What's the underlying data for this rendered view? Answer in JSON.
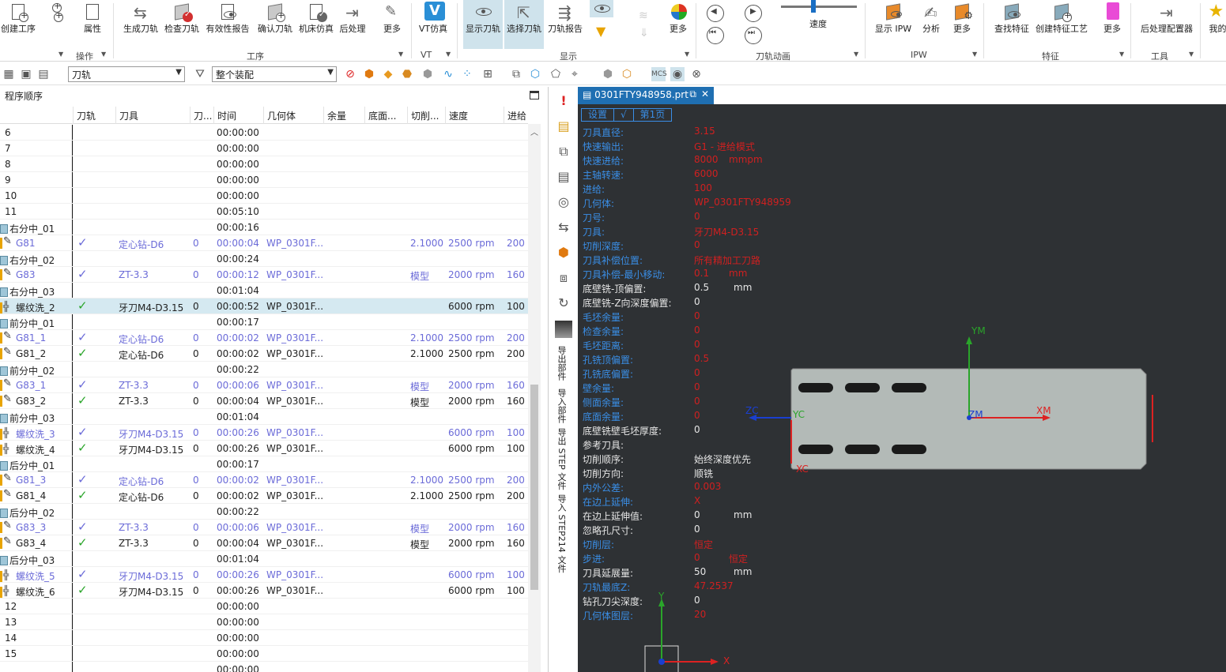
{
  "ribbon": {
    "buttons": [
      {
        "id": "create-op",
        "label": "创建工序"
      },
      {
        "id": "props",
        "label": "属性"
      },
      {
        "id": "gen-toolpath",
        "label": "生成刀轨"
      },
      {
        "id": "check-toolpath",
        "label": "检查刀轨"
      },
      {
        "id": "validity-report",
        "label": "有效性报告"
      },
      {
        "id": "confirm-toolpath",
        "label": "确认刀轨"
      },
      {
        "id": "machine-sim",
        "label": "机床仿真"
      },
      {
        "id": "postprocess",
        "label": "后处理"
      },
      {
        "id": "more-1",
        "label": "更多"
      },
      {
        "id": "vt-sim",
        "label": "VT仿真"
      },
      {
        "id": "show-toolpath",
        "label": "显示刀轨"
      },
      {
        "id": "select-toolpath",
        "label": "选择刀轨"
      },
      {
        "id": "toolpath-report",
        "label": "刀轨报告"
      },
      {
        "id": "more-2",
        "label": "更多"
      },
      {
        "id": "show-ipw",
        "label": "显示 IPW"
      },
      {
        "id": "analysis",
        "label": "分析"
      },
      {
        "id": "more-3",
        "label": "更多"
      },
      {
        "id": "find-feature",
        "label": "查找特征"
      },
      {
        "id": "create-feature-process",
        "label": "创建特征工艺"
      },
      {
        "id": "more-4",
        "label": "更多"
      },
      {
        "id": "post-configurator",
        "label": "后处理配置器"
      },
      {
        "id": "mine",
        "label": "我的"
      }
    ],
    "groups": [
      "操作",
      "工序",
      "VT",
      "显示",
      "刀轨动画",
      "IPW",
      "特征",
      "工具"
    ],
    "speed_label": "速度",
    "speed_fraction": 0.42
  },
  "toolbar2": {
    "filter_value": "刀轨",
    "scope_value": "整个装配"
  },
  "navigator": {
    "title": "程序顺序",
    "columns": [
      "刀轨",
      "刀具",
      "刀...",
      "时间",
      "几何体",
      "余量",
      "底面...",
      "切削...",
      "速度",
      "进给"
    ],
    "rows": [
      {
        "type": "plain",
        "name": "6",
        "time": "00:00:00"
      },
      {
        "type": "plain",
        "name": "7",
        "time": "00:00:00"
      },
      {
        "type": "plain",
        "name": "8",
        "time": "00:00:00"
      },
      {
        "type": "plain",
        "name": "9",
        "time": "00:00:00"
      },
      {
        "type": "plain",
        "name": "10",
        "time": "00:00:00"
      },
      {
        "type": "plain",
        "name": "11",
        "time": "00:05:10"
      },
      {
        "type": "group",
        "name": "右分中_01",
        "time": "00:00:16"
      },
      {
        "type": "op",
        "style": "blue",
        "icon": "drill",
        "name": "G81",
        "check": true,
        "tool": "定心钻-D6",
        "num": "0",
        "time": "00:00:04",
        "geom": "WP_0301F...",
        "cut": "2.1000",
        "speed": "2500 rpm",
        "feed": "200"
      },
      {
        "type": "group",
        "name": "右分中_02",
        "time": "00:00:24"
      },
      {
        "type": "op",
        "style": "blue",
        "icon": "drill",
        "name": "G83",
        "check": true,
        "tool": "ZT-3.3",
        "num": "0",
        "time": "00:00:12",
        "geom": "WP_0301F...",
        "cut": "模型",
        "speed": "2000 rpm",
        "feed": "160"
      },
      {
        "type": "group",
        "name": "右分中_03",
        "time": "00:01:04"
      },
      {
        "type": "op",
        "style": "black",
        "sel": true,
        "icon": "thread",
        "name": "螺纹洗_2",
        "check": true,
        "tool": "牙刀M4-D3.15",
        "num": "0",
        "time": "00:00:52",
        "geom": "WP_0301F...",
        "cut": "",
        "speed": "6000 rpm",
        "feed": "100"
      },
      {
        "type": "group",
        "name": "前分中_01",
        "time": "00:00:17"
      },
      {
        "type": "op",
        "style": "blue",
        "icon": "drill",
        "name": "G81_1",
        "check": true,
        "tool": "定心钻-D6",
        "num": "0",
        "time": "00:00:02",
        "geom": "WP_0301F...",
        "cut": "2.1000",
        "speed": "2500 rpm",
        "feed": "200"
      },
      {
        "type": "op",
        "style": "black",
        "icon": "drill",
        "name": "G81_2",
        "check": true,
        "tool": "定心钻-D6",
        "num": "0",
        "time": "00:00:02",
        "geom": "WP_0301F...",
        "cut": "2.1000",
        "speed": "2500 rpm",
        "feed": "200"
      },
      {
        "type": "group",
        "name": "前分中_02",
        "time": "00:00:22"
      },
      {
        "type": "op",
        "style": "blue",
        "icon": "drill",
        "name": "G83_1",
        "check": true,
        "tool": "ZT-3.3",
        "num": "0",
        "time": "00:00:06",
        "geom": "WP_0301F...",
        "cut": "模型",
        "speed": "2000 rpm",
        "feed": "160"
      },
      {
        "type": "op",
        "style": "black",
        "icon": "drill",
        "name": "G83_2",
        "check": true,
        "tool": "ZT-3.3",
        "num": "0",
        "time": "00:00:04",
        "geom": "WP_0301F...",
        "cut": "模型",
        "speed": "2000 rpm",
        "feed": "160"
      },
      {
        "type": "group",
        "name": "前分中_03",
        "time": "00:01:04"
      },
      {
        "type": "op",
        "style": "blue",
        "icon": "thread",
        "name": "螺纹洗_3",
        "check": true,
        "tool": "牙刀M4-D3.15",
        "num": "0",
        "time": "00:00:26",
        "geom": "WP_0301F...",
        "cut": "",
        "speed": "6000 rpm",
        "feed": "100"
      },
      {
        "type": "op",
        "style": "black",
        "icon": "thread",
        "name": "螺纹洗_4",
        "check": true,
        "tool": "牙刀M4-D3.15",
        "num": "0",
        "time": "00:00:26",
        "geom": "WP_0301F...",
        "cut": "",
        "speed": "6000 rpm",
        "feed": "100"
      },
      {
        "type": "group",
        "name": "后分中_01",
        "time": "00:00:17"
      },
      {
        "type": "op",
        "style": "blue",
        "icon": "drill",
        "name": "G81_3",
        "check": true,
        "tool": "定心钻-D6",
        "num": "0",
        "time": "00:00:02",
        "geom": "WP_0301F...",
        "cut": "2.1000",
        "speed": "2500 rpm",
        "feed": "200"
      },
      {
        "type": "op",
        "style": "black",
        "icon": "drill",
        "name": "G81_4",
        "check": true,
        "tool": "定心钻-D6",
        "num": "0",
        "time": "00:00:02",
        "geom": "WP_0301F...",
        "cut": "2.1000",
        "speed": "2500 rpm",
        "feed": "200"
      },
      {
        "type": "group",
        "name": "后分中_02",
        "time": "00:00:22"
      },
      {
        "type": "op",
        "style": "blue",
        "icon": "drill",
        "name": "G83_3",
        "check": true,
        "tool": "ZT-3.3",
        "num": "0",
        "time": "00:00:06",
        "geom": "WP_0301F...",
        "cut": "模型",
        "speed": "2000 rpm",
        "feed": "160"
      },
      {
        "type": "op",
        "style": "black",
        "icon": "drill",
        "name": "G83_4",
        "check": true,
        "tool": "ZT-3.3",
        "num": "0",
        "time": "00:00:04",
        "geom": "WP_0301F...",
        "cut": "模型",
        "speed": "2000 rpm",
        "feed": "160"
      },
      {
        "type": "group",
        "name": "后分中_03",
        "time": "00:01:04"
      },
      {
        "type": "op",
        "style": "blue",
        "icon": "thread",
        "name": "螺纹洗_5",
        "check": true,
        "tool": "牙刀M4-D3.15",
        "num": "0",
        "time": "00:00:26",
        "geom": "WP_0301F...",
        "cut": "",
        "speed": "6000 rpm",
        "feed": "100"
      },
      {
        "type": "op",
        "style": "black",
        "icon": "thread",
        "name": "螺纹洗_6",
        "check": true,
        "tool": "牙刀M4-D3.15",
        "num": "0",
        "time": "00:00:26",
        "geom": "WP_0301F...",
        "cut": "",
        "speed": "6000 rpm",
        "feed": "100"
      },
      {
        "type": "plain",
        "name": "12",
        "time": "00:00:00"
      },
      {
        "type": "plain",
        "name": "13",
        "time": "00:00:00"
      },
      {
        "type": "plain",
        "name": "14",
        "time": "00:00:00"
      },
      {
        "type": "plain",
        "name": "15",
        "time": "00:00:00"
      },
      {
        "type": "plain",
        "name": "",
        "time": "00:00:00"
      }
    ]
  },
  "vstrip": {
    "labels": [
      "导出部件",
      "导入部件",
      "导出 STEP 文件",
      "导入 STEP214 文件"
    ]
  },
  "graphics": {
    "tab_title": "0301FTY948958.prt",
    "header": [
      "设置",
      "√",
      "第1页"
    ],
    "params": [
      {
        "k": "刀具直径:",
        "v": "3.15",
        "u": "",
        "c": "blue"
      },
      {
        "k": "快速输出:",
        "v": "G1 - 进给模式",
        "u": "",
        "c": "blue"
      },
      {
        "k": "快速进给:",
        "v": "8000",
        "u": "mmpm",
        "c": "blue"
      },
      {
        "k": "主轴转速:",
        "v": "6000",
        "u": "",
        "c": "blue"
      },
      {
        "k": "进给:",
        "v": "100",
        "u": "",
        "c": "blue"
      },
      {
        "k": "几何体:",
        "v": "WP_0301FTY948959",
        "u": "",
        "c": "blue"
      },
      {
        "k": "刀号:",
        "v": "0",
        "u": "",
        "c": "blue"
      },
      {
        "k": "刀具:",
        "v": "牙刀M4-D3.15",
        "u": "",
        "c": "blue"
      },
      {
        "k": "切削深度:",
        "v": "0",
        "u": "",
        "c": "blue"
      },
      {
        "k": "刀具补偿位置:",
        "v": "所有精加工刀路",
        "u": "",
        "c": "blue"
      },
      {
        "k": "刀具补偿-最小移动:",
        "v": "0.1",
        "u": "mm",
        "c": "blue"
      },
      {
        "k": "底壁铣-顶偏置:",
        "v": "0.5",
        "u": "mm",
        "c": "white"
      },
      {
        "k": "底壁铣-Z向深度偏置:",
        "v": "0",
        "u": "",
        "c": "white"
      },
      {
        "k": "毛坯余量:",
        "v": "0",
        "u": "",
        "c": "blue"
      },
      {
        "k": "检查余量:",
        "v": "0",
        "u": "",
        "c": "blue"
      },
      {
        "k": "毛坯距离:",
        "v": "0",
        "u": "",
        "c": "blue"
      },
      {
        "k": "孔铣顶偏置:",
        "v": "0.5",
        "u": "",
        "c": "blue"
      },
      {
        "k": "孔铣底偏置:",
        "v": "0",
        "u": "",
        "c": "blue"
      },
      {
        "k": "壁余量:",
        "v": "0",
        "u": "",
        "c": "blue"
      },
      {
        "k": "侧面余量:",
        "v": "0",
        "u": "",
        "c": "blue"
      },
      {
        "k": "底面余量:",
        "v": "0",
        "u": "",
        "c": "blue"
      },
      {
        "k": "底壁铣壁毛坯厚度:",
        "v": "0",
        "u": "",
        "c": "white"
      },
      {
        "k": "参考刀具:",
        "v": "",
        "u": "",
        "c": "white"
      },
      {
        "k": "切削顺序:",
        "v": "始终深度优先",
        "u": "",
        "c": "white"
      },
      {
        "k": "切削方向:",
        "v": "顺铣",
        "u": "",
        "c": "white"
      },
      {
        "k": "内外公差:",
        "v": "0.003",
        "u": "",
        "c": "blue"
      },
      {
        "k": "在边上延伸:",
        "v": "X",
        "u": "",
        "c": "blue"
      },
      {
        "k": "在边上延伸值:",
        "v": "0",
        "u": "mm",
        "c": "white"
      },
      {
        "k": "忽略孔尺寸:",
        "v": "0",
        "u": "",
        "c": "white"
      },
      {
        "k": "切削层:",
        "v": "恒定",
        "u": "",
        "c": "blue"
      },
      {
        "k": "步进:",
        "v": "0",
        "u": "恒定",
        "c": "blue"
      },
      {
        "k": "刀具延展量:",
        "v": "50",
        "u": "mm",
        "c": "white"
      },
      {
        "k": "刀轨最底Z:",
        "v": "47.2537",
        "u": "",
        "c": "blue"
      },
      {
        "k": "钻孔刀尖深度:",
        "v": "0",
        "u": "",
        "c": "white"
      },
      {
        "k": "几何体图层:",
        "v": "20",
        "u": "",
        "c": "blue"
      }
    ],
    "axes": {
      "ym": "YM",
      "xm": "XM",
      "zm": "ZM",
      "zc": "ZC",
      "yc": "YC",
      "xc": "XC",
      "y": "Y",
      "x": "X"
    }
  },
  "colors": {
    "accent": "#1f6fb2",
    "param_blue": "#3a8ee6",
    "param_red": "#d02020",
    "viewport_bg": "#2e3134",
    "part_fill": "#b3bab7",
    "check_green": "#2aa52a"
  }
}
